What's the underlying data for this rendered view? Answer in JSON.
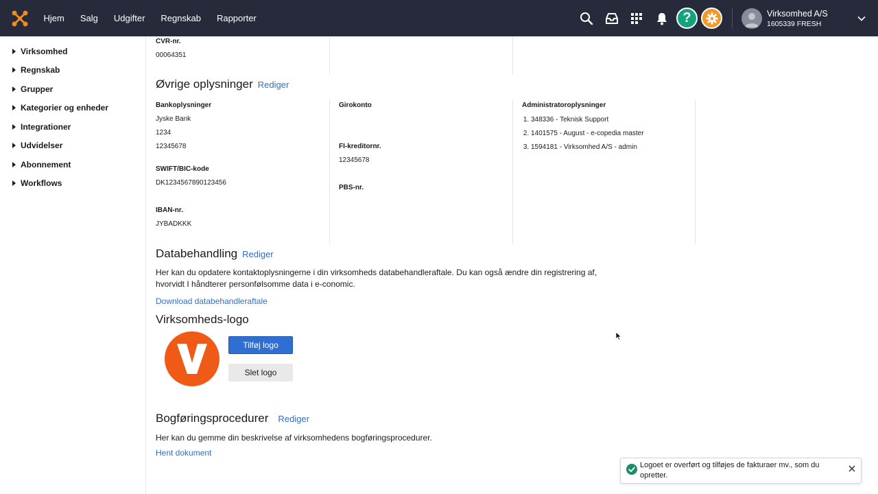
{
  "nav": {
    "items": [
      "Hjem",
      "Salg",
      "Udgifter",
      "Regnskab",
      "Rapporter"
    ]
  },
  "header": {
    "company_name": "Virksomhed A/S",
    "company_id": "1605339 FRESH",
    "help_label": "?"
  },
  "sidebar": {
    "items": [
      "Virksomhed",
      "Regnskab",
      "Grupper",
      "Kategorier og enheder",
      "Integrationer",
      "Udvidelser",
      "Abonnement",
      "Workflows"
    ]
  },
  "company": {
    "cvr_label": "CVR-nr.",
    "cvr_value": "00064351"
  },
  "other_info": {
    "title": "Øvrige oplysninger",
    "edit": "Rediger",
    "bank_label": "Bankoplysninger",
    "bank_name": "Jyske Bank",
    "bank_reg": "1234",
    "bank_account": "12345678",
    "swift_label": "SWIFT/BIC-kode",
    "swift_value": "DK1234567890123456",
    "iban_label": "IBAN-nr.",
    "iban_value": "JYBADKKK",
    "giro_label": "Girokonto",
    "fi_label": "FI-kreditornr.",
    "fi_value": "12345678",
    "pbs_label": "PBS-nr.",
    "admin_label": "Administratoroplysninger",
    "admins": [
      "348336 - Teknisk Support",
      "1401575 - August - e-copedia master",
      "1594181 - Virksomhed A/S - admin"
    ]
  },
  "data_processing": {
    "title": "Databehandling",
    "edit": "Rediger",
    "description_line1": "Her kan du opdatere kontaktoplysningerne i din virksomheds databehandleraftale. Du kan også ændre din registrering af,",
    "description_line2": "hvorvidt I håndterer personfølsomme data i e-conomic.",
    "download_link": "Download databehandleraftale"
  },
  "logo_section": {
    "title": "Virksomheds-logo",
    "add_button": "Tilføj logo",
    "delete_button": "Slet logo"
  },
  "bookkeeping": {
    "title": "Bogføringsprocedurer",
    "edit": "Rediger",
    "description": "Her kan du gemme din beskrivelse af virksomhedens bogføringsprocedurer.",
    "link": "Hent dokument"
  },
  "toast": {
    "line1": "Logoet er overført og tilføjes de fakturaer mv., som du",
    "line2": "opretter."
  },
  "colors": {
    "topbar": "#262a3b",
    "accent_link": "#2f6fc6",
    "primary_button": "#2f6fd4",
    "help": "#14a37f",
    "settings": "#ef9a2a",
    "logo": "#ef5a17",
    "success": "#1d8a6a"
  }
}
